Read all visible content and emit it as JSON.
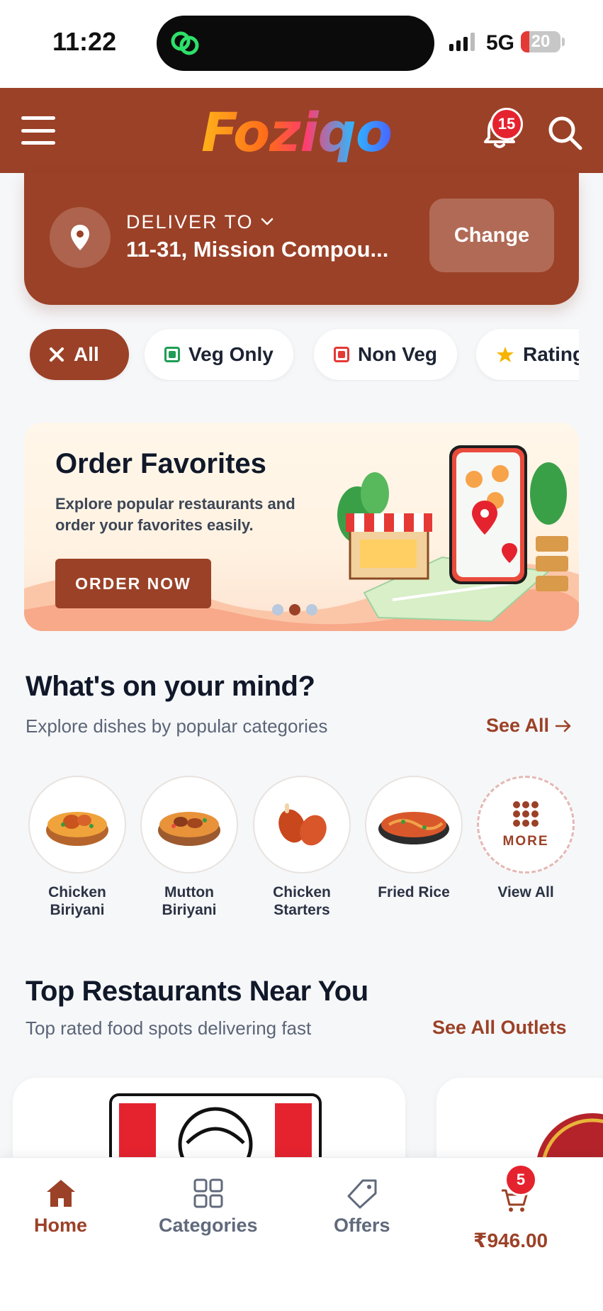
{
  "status_bar": {
    "time": "11:22",
    "network": "5G",
    "battery": "20"
  },
  "header": {
    "app_name": "Foziqo",
    "notification_count": "15"
  },
  "delivery": {
    "label": "DELIVER TO",
    "address": "11-31, Mission Compou...",
    "change_label": "Change"
  },
  "filters": [
    {
      "label": "All",
      "active": true
    },
    {
      "label": "Veg Only"
    },
    {
      "label": "Non Veg"
    },
    {
      "label": "Rating"
    }
  ],
  "banner": {
    "title": "Order Favorites",
    "subtitle": "Explore popular restaurants and order your favorites easily.",
    "cta": "ORDER NOW",
    "slide_index": 2,
    "slide_count": 3
  },
  "mind_section": {
    "title": "What's on your mind?",
    "subtitle": "Explore dishes by popular categories",
    "see_all": "See All"
  },
  "categories": [
    {
      "label": "Chicken Biriyani"
    },
    {
      "label": "Mutton Biriyani"
    },
    {
      "label": "Chicken Starters"
    },
    {
      "label": "Fried Rice"
    },
    {
      "label": "View All",
      "badge": "MORE"
    }
  ],
  "restaurants_section": {
    "title": "Top Restaurants Near You",
    "subtitle": "Top rated food spots delivering fast",
    "see_all": "See All Outlets"
  },
  "bottom_nav": {
    "items": [
      {
        "label": "Home",
        "active": true
      },
      {
        "label": "Categories"
      },
      {
        "label": "Offers"
      }
    ],
    "cart_count": "5",
    "cart_total": "₹946.00"
  },
  "colors": {
    "brand": "#9b4127",
    "badge": "#e5232f",
    "veg": "#1f9d55",
    "non_veg": "#e53935",
    "star": "#f5b400"
  }
}
